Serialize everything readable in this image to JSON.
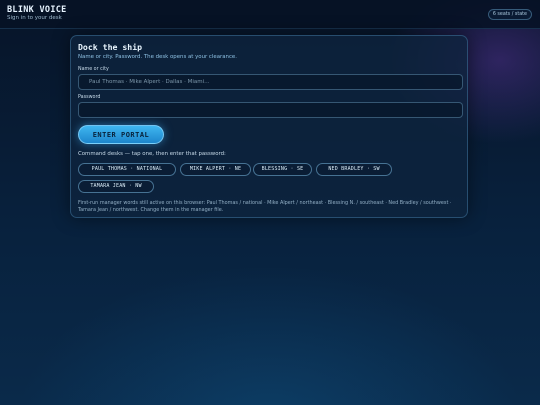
{
  "app": {
    "title": "BLINK VOICE",
    "subtitle": "Sign in to your desk",
    "seats_badge": "6 seats / state"
  },
  "login": {
    "title": "Dock the ship",
    "subtitle": "Name or city. Password. The desk opens at your clearance.",
    "name_label": "Name or city",
    "name_value": "",
    "name_placeholder": "Paul Thomas · Mike Alpert · Dallas · Miami…",
    "password_label": "Password",
    "password_value": "",
    "password_placeholder": "",
    "submit_label": "ENTER PORTAL"
  },
  "desks": {
    "hint": "Command desks — tap one, then enter that password:",
    "chips": [
      "PAUL THOMAS · NATIONAL",
      "MIKE ALPERT · NE",
      "BLESSING · SE",
      "NED BRADLEY · SW",
      "TAMARA JEAN · NW"
    ]
  },
  "footnote": "First-run manager words still active on this browser: Paul Thomas / national · Mike Alpert / northeast · Blessing N. / southeast · Ned Bradley / southwest · Tamara Jean / northwest. Change them in the manager file.",
  "colors": {
    "accent": "#2ea3e6",
    "background": "#08213d",
    "card": "#0e243e"
  }
}
